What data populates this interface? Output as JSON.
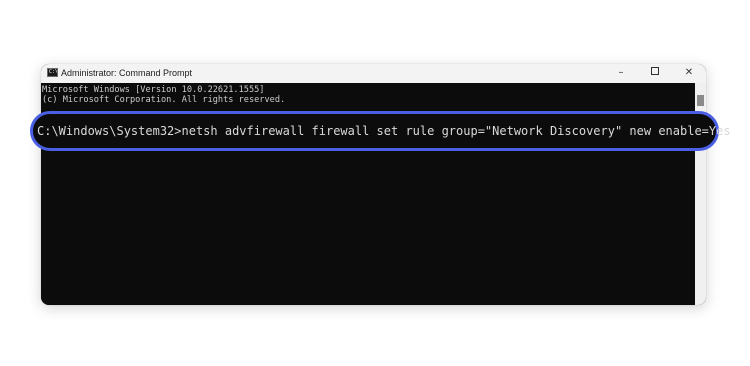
{
  "window": {
    "icon_label": "C:\\",
    "title": "Administrator: Command Prompt",
    "minimize_glyph": "–",
    "close_glyph": "✕"
  },
  "console": {
    "lines": [
      "Microsoft Windows [Version 10.0.22621.1555]",
      "(c) Microsoft Corporation. All rights reserved."
    ],
    "command": "C:\\Windows\\System32>netsh advfirewall firewall set rule group=\"Network Discovery\" new enable=Yes"
  },
  "colors": {
    "highlight_border": "#4a5fe3",
    "console_background": "#0c0c0c",
    "console_text": "#cccccc"
  }
}
